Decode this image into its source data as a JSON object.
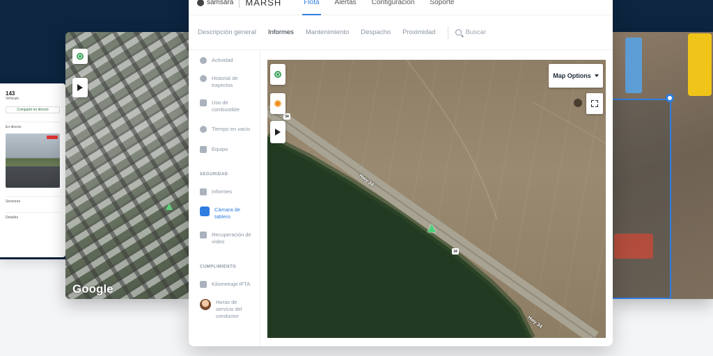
{
  "app": {
    "brand": "samsara",
    "org": "MARSH",
    "tabs": [
      "Flota",
      "Alertas",
      "Configuración",
      "Soporte"
    ]
  },
  "subnav": {
    "items": [
      "Descripción general",
      "Informes",
      "Mantenimiento",
      "Despacho",
      "Proximidad"
    ],
    "active": "Informes",
    "search_placeholder": "Buscar"
  },
  "sidebar": {
    "items": [
      {
        "label": "Actividad",
        "icon": "activity-icon"
      },
      {
        "label": "Historial de trayectos",
        "icon": "history-icon"
      },
      {
        "label": "Uso de combustible",
        "icon": "fuel-icon"
      },
      {
        "label": "Tiempo en vacío",
        "icon": "idle-clock-icon"
      },
      {
        "label": "Equipo",
        "icon": "equipment-icon"
      }
    ],
    "section_security": "SEGURIDAD",
    "security_items": [
      {
        "label": "Informes",
        "icon": "bar-chart-icon"
      },
      {
        "label": "Cámara de tablero",
        "icon": "dashcam-icon",
        "active": true
      },
      {
        "label": "Recuperación de vídeo",
        "icon": "download-icon"
      }
    ],
    "section_compliance": "CUMPLIMIENTO",
    "compliance_items": [
      {
        "label": "Kilometraje IFTA",
        "icon": "play-icon"
      },
      {
        "label": "Horas de servicio del conductor",
        "icon": "driver-avatar"
      }
    ]
  },
  "map": {
    "options_label": "Map Options",
    "road_label_1": "Hwy 34",
    "road_label_2": "Hwy 34",
    "shield_1": "34",
    "shield_2": "34"
  },
  "left_card": {
    "number": "143",
    "subtitle": "Vehículo",
    "button_label": "Compartir en directo",
    "section_1": "En directo",
    "section_2": "Sensores",
    "section_3": "Detalles"
  },
  "city_card": {
    "watermark": "Google"
  },
  "colors": {
    "accent": "#2f7de0",
    "navy": "#0d2540",
    "marker_green": "#4fd07a",
    "marker_orange": "#f08c1a"
  }
}
